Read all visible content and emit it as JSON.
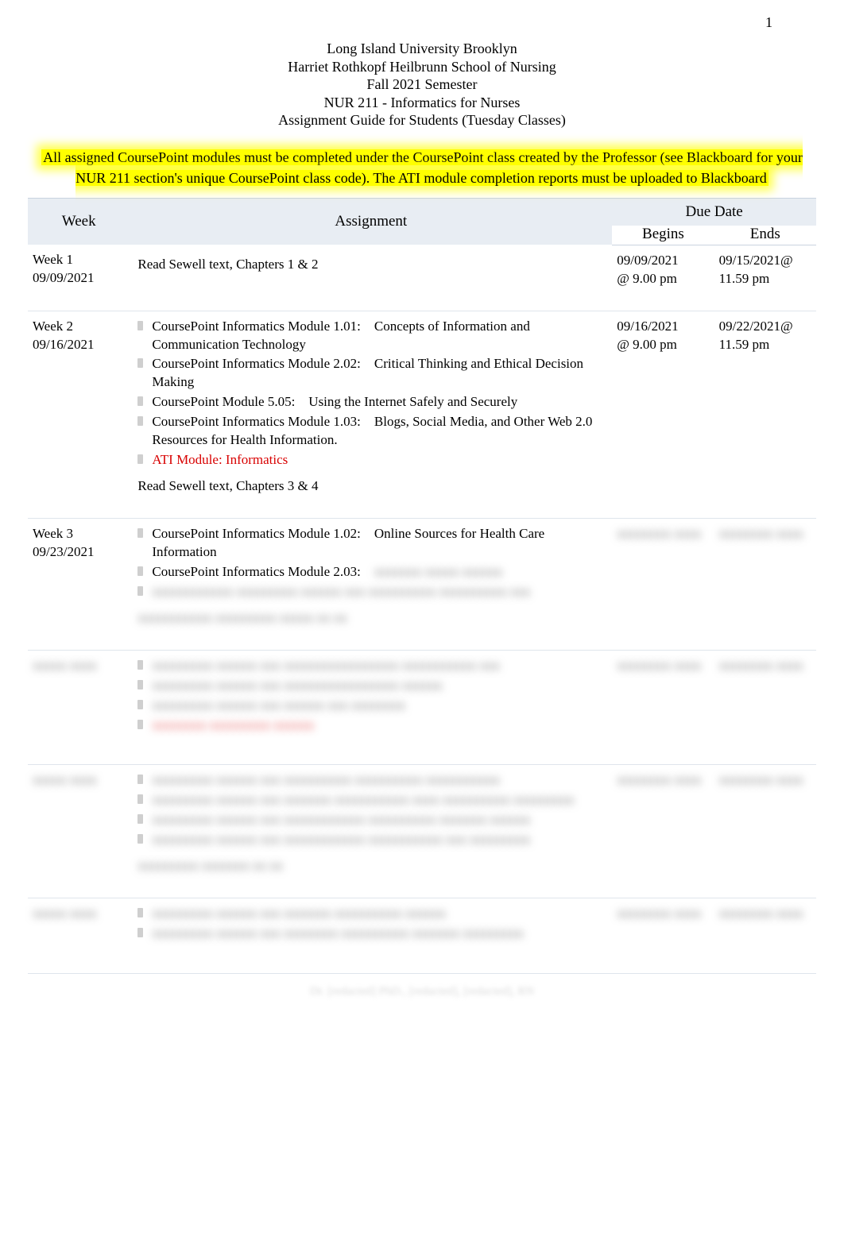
{
  "page_number": "1",
  "header": {
    "line1": "Long Island University Brooklyn",
    "line2": "Harriet Rothkopf Heilbrunn School of Nursing",
    "line3": "Fall 2021 Semester",
    "line4": "NUR 211 - Informatics for Nurses",
    "line5": "Assignment Guide for Students (Tuesday Classes)"
  },
  "notice": "All assigned CoursePoint modules must be completed under the CoursePoint class created by the Professor (see Blackboard for your NUR 211 section's unique CoursePoint class code). The ATI module completion reports must be uploaded to Blackboard",
  "table_headers": {
    "week": "Week",
    "assignment": "Assignment",
    "due_date": "Due Date",
    "begins": "Begins",
    "ends": "Ends"
  },
  "rows": [
    {
      "week_label": "Week 1",
      "week_date": "09/09/2021",
      "reading": "Read Sewell text, Chapters 1 & 2",
      "begins_date": "09/09/2021",
      "begins_time": "@ 9.00 pm",
      "ends_date": "09/15/2021@",
      "ends_time": "11.59 pm"
    },
    {
      "week_label": "Week 2",
      "week_date": "09/16/2021",
      "items": [
        "CoursePoint Informatics Module 1.01: Concepts of Information and Communication Technology",
        "CoursePoint Informatics Module 2.02: Critical Thinking and Ethical Decision Making",
        "CoursePoint Module 5.05: Using the Internet Safely and Securely",
        "CoursePoint Informatics Module 1.03: Blogs, Social Media, and Other Web 2.0 Resources for Health Information."
      ],
      "ati_item": "ATI Module: Informatics",
      "reading": "Read Sewell text, Chapters 3 & 4",
      "begins_date": "09/16/2021",
      "begins_time": "@ 9.00 pm",
      "ends_date": "09/22/2021@",
      "ends_time": "11.59 pm"
    },
    {
      "week_label": "Week 3",
      "week_date": "09/23/2021",
      "items": [
        "CoursePoint Informatics Module 1.02: Online Sources for Health Care Information",
        "CoursePoint Informatics Module 2.03: "
      ]
    }
  ],
  "obscured_rows": [
    {
      "week": "xxxxx xxxx",
      "lines": [
        "xxxxxxxxxxxx xxxxxxxxx xxxxxx xxx xxxxxxxxxx xxxxxxxxxx xxx",
        "xxxxxxxxxxx xxxxxxxxx xxxxx xx xx"
      ],
      "begins": "xxxxxxxx xxxx",
      "ends": "xxxxxxxx xxxx"
    },
    {
      "week": "xxxxx xxxx",
      "lines": [
        "xxxxxxxxx xxxxxx xxx xxxxxxxxxxxxxxxxx xxxxxxxxxxx xxx",
        "xxxxxxxxx xxxxxx xxx xxxxxxxxxxxxxxxxx xxxxxx",
        "xxxxxxxxx xxxxxx xxx xxxxxx xxx xxxxxxxx"
      ],
      "red_line": "xxxxxxxx xxxxxxxxx xxxxxx",
      "begins": "xxxxxxxx xxxx",
      "ends": "xxxxxxxx xxxx"
    },
    {
      "week": "xxxxx xxxx",
      "lines": [
        "xxxxxxxxx xxxxxx xxx xxxxxxxxxx xxxxxxxxxx xxxxxxxxxxx",
        "xxxxxxxxx xxxxxx xxx xxxxxxx xxxxxxxxxxx xxxx xxxxxxxxxx xxxxxxxxx",
        "",
        "xxxxxxxxx xxxxxx xxx xxxxxxxxxxxx xxxxxxxxxx xxxxxxx xxxxxx",
        "",
        "xxxxxxxxx xxxxxx xxx xxxxxxxxxxxx xxxxxxxxxxx xxx xxxxxxxxx",
        "",
        "xxxxxxxxx xxxxxxx xx xx"
      ],
      "begins": "xxxxxxxx xxxx",
      "ends": "xxxxxxxx xxxx"
    },
    {
      "week": "xxxxx xxxx",
      "lines": [
        "",
        "xxxxxxxxx xxxxxx xxx xxxxxxx xxxxxxxxxx xxxxxx",
        "",
        "xxxxxxxxx xxxxxx xxx xxxxxxxx xxxxxxxxxx xxxxxxx xxxxxxxxx"
      ],
      "begins": "xxxxxxxx xxxx",
      "ends": "xxxxxxxx xxxx"
    }
  ],
  "footer_author": "Dr. [redacted] PhD., [redacted], [redacted], RN"
}
